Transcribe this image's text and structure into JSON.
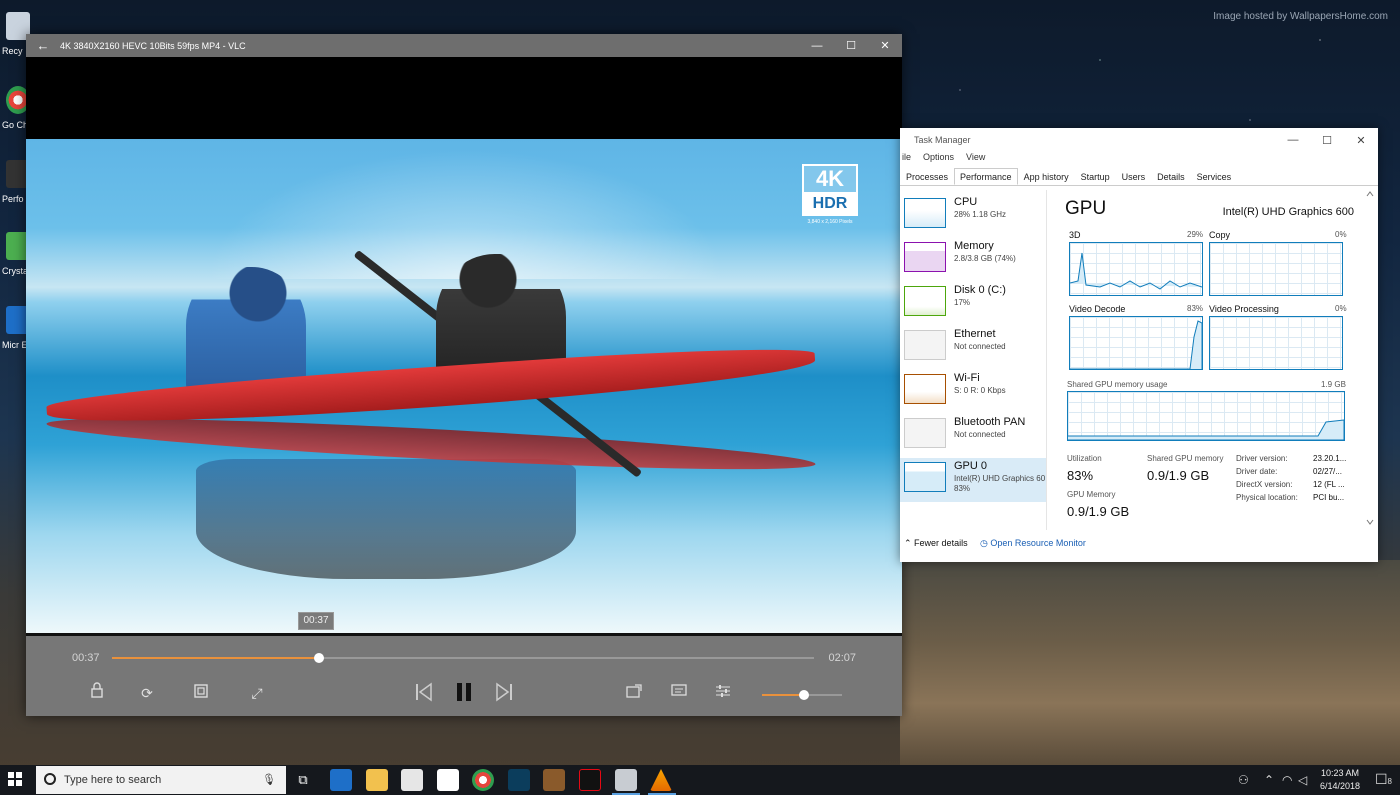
{
  "desktop": {
    "watermark": "Image hosted by WallpapersHome.com",
    "icons": [
      {
        "label": "Recy"
      },
      {
        "label": "Go Chr"
      },
      {
        "label": "Perfo"
      },
      {
        "label": "Crysta"
      },
      {
        "label": "Micr E"
      }
    ]
  },
  "vlc": {
    "title": "4K 3840X2160 HEVC 10Bits 59fps MP4 - VLC",
    "badge_top": "4K",
    "badge_bottom": "HDR",
    "badge_sub": "3,840 x 2,160 Pixels",
    "time_tooltip": "00:37",
    "time_current": "00:37",
    "time_total": "02:07",
    "progress_fraction": 0.295,
    "volume_fraction": 0.53,
    "controls": {
      "lock_icon": "lock-icon",
      "loop_icon": "repeat-icon",
      "aspect_icon": "aspect-ratio-icon",
      "fullscreen_icon": "expand-icon",
      "prev_icon": "skip-previous-icon",
      "pause_icon": "pause-icon",
      "next_icon": "skip-next-icon",
      "cast_icon": "cast-icon",
      "subtitle_icon": "subtitle-icon",
      "equalizer_icon": "sliders-icon"
    },
    "accent": "#e9913c"
  },
  "task_manager": {
    "title": "Task Manager",
    "menu": [
      "ile",
      "Options",
      "View"
    ],
    "tabs": [
      "Processes",
      "Performance",
      "App history",
      "Startup",
      "Users",
      "Details",
      "Services"
    ],
    "active_tab": "Performance",
    "resources": [
      {
        "name": "CPU",
        "sub": "28% 1.18 GHz",
        "sub2": ""
      },
      {
        "name": "Memory",
        "sub": "2.8/3.8 GB (74%)",
        "sub2": ""
      },
      {
        "name": "Disk 0 (C:)",
        "sub": "17%",
        "sub2": ""
      },
      {
        "name": "Ethernet",
        "sub": "Not connected",
        "sub2": ""
      },
      {
        "name": "Wi-Fi",
        "sub": "S: 0 R: 0 Kbps",
        "sub2": ""
      },
      {
        "name": "Bluetooth PAN",
        "sub": "Not connected",
        "sub2": ""
      },
      {
        "name": "GPU 0",
        "sub": "Intel(R) UHD Graphics 60",
        "sub2": "83%"
      }
    ],
    "gpu": {
      "heading": "GPU",
      "model": "Intel(R) UHD Graphics 600",
      "engines": [
        {
          "label": "3D",
          "pct": "29%"
        },
        {
          "label": "Copy",
          "pct": "0%"
        },
        {
          "label": "Video Decode",
          "pct": "83%"
        },
        {
          "label": "Video Processing",
          "pct": "0%"
        }
      ],
      "shared_label": "Shared GPU memory usage",
      "shared_max": "1.9 GB",
      "utilization_label": "Utilization",
      "utilization_value": "83%",
      "shared_mem_label": "Shared GPU memory",
      "shared_mem_value": "0.9/1.9 GB",
      "gpu_mem_label": "GPU Memory",
      "gpu_mem_value": "0.9/1.9 GB",
      "info": [
        {
          "key": "Driver version:",
          "value": "23.20.1..."
        },
        {
          "key": "Driver date:",
          "value": "02/27/..."
        },
        {
          "key": "DirectX version:",
          "value": "12 (FL ..."
        },
        {
          "key": "Physical location:",
          "value": "PCI bu..."
        }
      ]
    },
    "footer": {
      "fewer_details": "Fewer details",
      "open_resource_monitor": "Open Resource Monitor"
    },
    "accent": "#117dbb"
  },
  "taskbar": {
    "search_placeholder": "Type here to search",
    "time": "10:23 AM",
    "date": "6/14/2018",
    "notification_count": "8"
  }
}
